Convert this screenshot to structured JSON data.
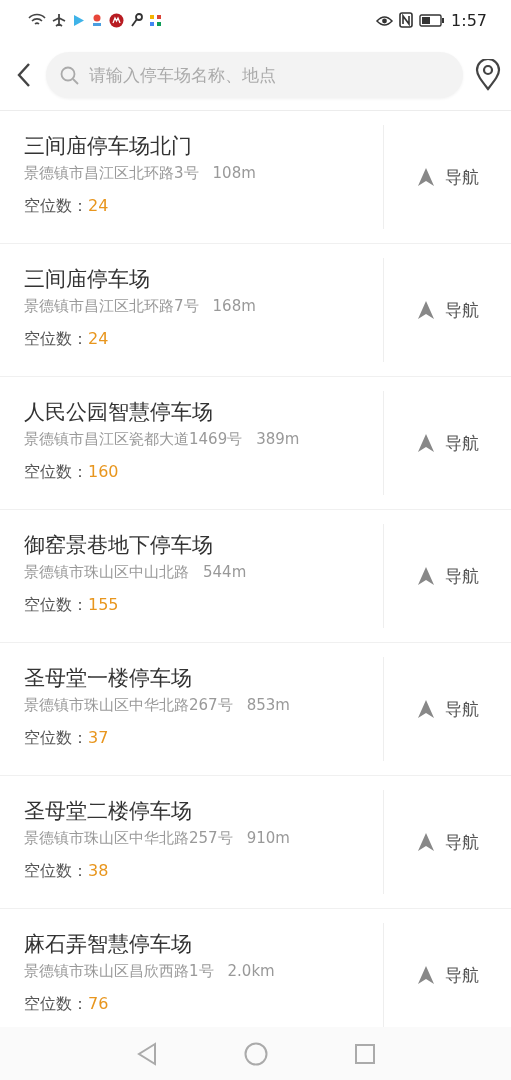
{
  "status_bar": {
    "time": "1:57"
  },
  "search": {
    "placeholder": "请输入停车场名称、地点"
  },
  "parking_lots": [
    {
      "name": "三间庙停车场北门",
      "address": "景德镇市昌江区北环路3号",
      "distance": "108m",
      "spaces_label": "空位数：",
      "spaces": "24",
      "nav_label": "导航"
    },
    {
      "name": "三间庙停车场",
      "address": "景德镇市昌江区北环路7号",
      "distance": "168m",
      "spaces_label": "空位数：",
      "spaces": "24",
      "nav_label": "导航"
    },
    {
      "name": "人民公园智慧停车场",
      "address": "景德镇市昌江区瓷都大道1469号",
      "distance": "389m",
      "spaces_label": "空位数：",
      "spaces": "160",
      "nav_label": "导航"
    },
    {
      "name": "御窑景巷地下停车场",
      "address": "景德镇市珠山区中山北路",
      "distance": "544m",
      "spaces_label": "空位数：",
      "spaces": "155",
      "nav_label": "导航"
    },
    {
      "name": "圣母堂一楼停车场",
      "address": "景德镇市珠山区中华北路267号",
      "distance": "853m",
      "spaces_label": "空位数：",
      "spaces": "37",
      "nav_label": "导航"
    },
    {
      "name": "圣母堂二楼停车场",
      "address": "景德镇市珠山区中华北路257号",
      "distance": "910m",
      "spaces_label": "空位数：",
      "spaces": "38",
      "nav_label": "导航"
    },
    {
      "name": "麻石弄智慧停车场",
      "address": "景德镇市珠山区昌欣西路1号",
      "distance": "2.0km",
      "spaces_label": "空位数：",
      "spaces": "76",
      "nav_label": "导航"
    }
  ]
}
